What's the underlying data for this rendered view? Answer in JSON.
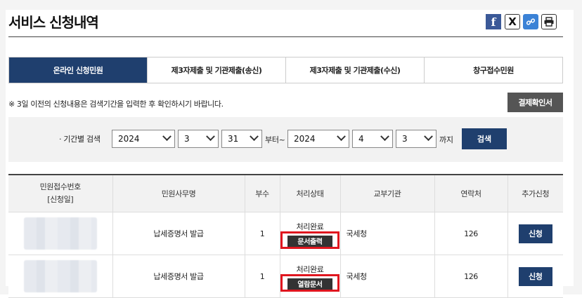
{
  "page": {
    "title": "서비스 신청내역"
  },
  "share": {
    "facebook": "f",
    "x": "X",
    "link": "🔗"
  },
  "tabs": [
    {
      "label": "온라인 신청민원",
      "active": true
    },
    {
      "label": "제3자제출 및 기관제출(송신)",
      "active": false
    },
    {
      "label": "제3자제출 및 기관제출(수신)",
      "active": false
    },
    {
      "label": "창구접수민원",
      "active": false
    }
  ],
  "notice": "※ 3일 이전의 신청내용은 검색기간을 입력한 후 확인하시기 바랍니다.",
  "payment_button": "결제확인서",
  "search": {
    "label": "· 기간별 검색",
    "from": {
      "year": "2024",
      "month": "3",
      "day": "31"
    },
    "from_suffix": "부터~",
    "to": {
      "year": "2024",
      "month": "4",
      "day": "3"
    },
    "to_suffix": "까지",
    "button": "검색"
  },
  "table": {
    "headers": [
      "민원접수번호\n[신청일]",
      "민원사무명",
      "부수",
      "처리상태",
      "교부기관",
      "연락처",
      "추가신청"
    ],
    "rows": [
      {
        "name": "납세증명서 발급",
        "copies": "1",
        "status": "처리완료",
        "doc_button": "문서출력",
        "agency": "국세청",
        "contact": "126",
        "apply": "신청"
      },
      {
        "name": "납세증명서 발급",
        "copies": "1",
        "status": "처리완료",
        "doc_button": "열람문서",
        "agency": "국세청",
        "contact": "126",
        "apply": "신청"
      }
    ]
  },
  "colors": {
    "primary": "#1f3f6e",
    "highlight": "#e0161f",
    "gray_button": "#555555"
  }
}
